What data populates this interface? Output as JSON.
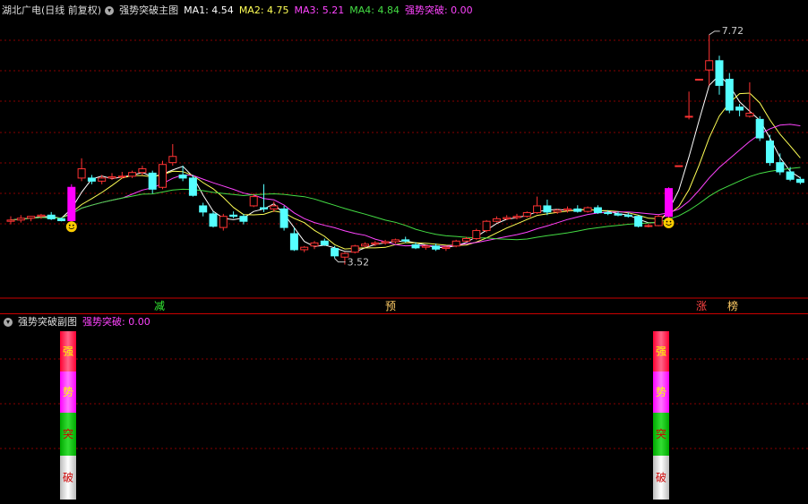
{
  "main": {
    "title": "湖北广电(日线 前复权)",
    "indicator": "强势突破主图",
    "ma": [
      {
        "label": "MA1: 4.54",
        "color": "#ffffff"
      },
      {
        "label": "MA2: 4.75",
        "color": "#ffff55"
      },
      {
        "label": "MA3: 5.21",
        "color": "#ff44ff"
      },
      {
        "label": "MA4: 4.84",
        "color": "#44dd44"
      }
    ],
    "signal": {
      "label": "强势突破: 0.00",
      "color": "#ff44ff"
    },
    "high_label": "7.72",
    "low_label": "3.52",
    "markers": [
      "减",
      "预",
      "涨",
      "榜"
    ]
  },
  "sub": {
    "indicator": "强势突破副图",
    "signal": {
      "label": "强势突破: 0.00",
      "color": "#ff44ff"
    },
    "bar_chars": [
      "强",
      "势",
      "突",
      "破"
    ]
  },
  "colors": {
    "up": "#ff3333",
    "down": "#55ffff",
    "grid": "#880000",
    "highlight": "#ff00ff"
  },
  "chart_data": {
    "type": "candlestick",
    "candles": [
      [
        4.7,
        4.78,
        4.65,
        4.72
      ],
      [
        4.72,
        4.8,
        4.68,
        4.75
      ],
      [
        4.75,
        4.78,
        4.7,
        4.78
      ],
      [
        4.78,
        4.82,
        4.74,
        4.8
      ],
      [
        4.8,
        4.85,
        4.72,
        4.74
      ],
      [
        4.74,
        4.76,
        4.7,
        4.71
      ],
      [
        4.71,
        5.3,
        4.7,
        5.25
      ],
      [
        5.4,
        5.72,
        5.35,
        5.55
      ],
      [
        5.4,
        5.45,
        5.3,
        5.35
      ],
      [
        5.35,
        5.45,
        5.3,
        5.4
      ],
      [
        5.4,
        5.48,
        5.37,
        5.42
      ],
      [
        5.42,
        5.5,
        5.39,
        5.43
      ],
      [
        5.43,
        5.52,
        5.4,
        5.49
      ],
      [
        5.49,
        5.6,
        5.45,
        5.55
      ],
      [
        5.48,
        5.52,
        5.15,
        5.22
      ],
      [
        5.25,
        5.68,
        5.22,
        5.62
      ],
      [
        5.65,
        5.95,
        5.6,
        5.75
      ],
      [
        5.45,
        5.6,
        5.35,
        5.4
      ],
      [
        5.4,
        5.45,
        5.1,
        5.12
      ],
      [
        4.95,
        5.0,
        4.78,
        4.85
      ],
      [
        4.82,
        4.86,
        4.6,
        4.62
      ],
      [
        4.6,
        4.82,
        4.55,
        4.78
      ],
      [
        4.8,
        4.86,
        4.75,
        4.78
      ],
      [
        4.78,
        4.82,
        4.65,
        4.7
      ],
      [
        4.95,
        5.15,
        4.93,
        5.1
      ],
      [
        4.92,
        5.3,
        4.85,
        4.9
      ],
      [
        4.9,
        5.02,
        4.85,
        4.95
      ],
      [
        4.9,
        4.95,
        4.55,
        4.6
      ],
      [
        4.5,
        4.6,
        4.22,
        4.24
      ],
      [
        4.24,
        4.3,
        4.2,
        4.28
      ],
      [
        4.3,
        4.38,
        4.25,
        4.35
      ],
      [
        4.38,
        4.42,
        4.3,
        4.32
      ],
      [
        4.26,
        4.3,
        4.1,
        4.14
      ],
      [
        4.12,
        4.2,
        4.0,
        4.18
      ],
      [
        4.2,
        4.32,
        4.18,
        4.3
      ],
      [
        4.3,
        4.36,
        4.28,
        4.33
      ],
      [
        4.33,
        4.38,
        4.3,
        4.35
      ],
      [
        4.35,
        4.4,
        4.32,
        4.37
      ],
      [
        4.37,
        4.42,
        4.34,
        4.4
      ],
      [
        4.4,
        4.45,
        4.35,
        4.38
      ],
      [
        4.32,
        4.36,
        4.25,
        4.27
      ],
      [
        4.28,
        4.32,
        4.24,
        4.3
      ],
      [
        4.3,
        4.34,
        4.22,
        4.25
      ],
      [
        4.26,
        4.3,
        4.22,
        4.28
      ],
      [
        4.3,
        4.4,
        4.28,
        4.38
      ],
      [
        4.38,
        4.45,
        4.36,
        4.42
      ],
      [
        4.42,
        4.58,
        4.4,
        4.55
      ],
      [
        4.55,
        4.72,
        4.52,
        4.7
      ],
      [
        4.7,
        4.78,
        4.68,
        4.74
      ],
      [
        4.74,
        4.8,
        4.72,
        4.76
      ],
      [
        4.76,
        4.82,
        4.73,
        4.78
      ],
      [
        4.78,
        4.86,
        4.76,
        4.84
      ],
      [
        4.84,
        5.1,
        4.82,
        4.95
      ],
      [
        4.95,
        5.05,
        4.8,
        4.85
      ],
      [
        4.85,
        4.9,
        4.82,
        4.88
      ],
      [
        4.88,
        4.94,
        4.84,
        4.9
      ],
      [
        4.9,
        4.96,
        4.84,
        4.86
      ],
      [
        4.86,
        4.94,
        4.84,
        4.92
      ],
      [
        4.92,
        4.96,
        4.82,
        4.84
      ],
      [
        4.84,
        4.88,
        4.8,
        4.83
      ],
      [
        4.82,
        4.86,
        4.78,
        4.8
      ],
      [
        4.8,
        4.84,
        4.76,
        4.78
      ],
      [
        4.78,
        4.8,
        4.6,
        4.62
      ],
      [
        4.62,
        4.66,
        4.6,
        4.63
      ],
      [
        4.63,
        4.8,
        4.62,
        4.78
      ],
      [
        4.78,
        5.25,
        4.76,
        5.23
      ],
      [
        5.6,
        5.6,
        5.6,
        5.6
      ],
      [
        6.4,
        6.8,
        6.35,
        6.4
      ],
      [
        7.0,
        7.0,
        7.0,
        7.0
      ],
      [
        7.15,
        7.72,
        6.9,
        7.3
      ],
      [
        7.3,
        7.38,
        6.75,
        6.9
      ],
      [
        7.0,
        7.1,
        6.45,
        6.5
      ],
      [
        6.55,
        6.6,
        6.4,
        6.5
      ],
      [
        6.4,
        6.95,
        6.38,
        6.45
      ],
      [
        6.35,
        6.4,
        6.0,
        6.05
      ],
      [
        6.0,
        6.1,
        5.6,
        5.65
      ],
      [
        5.65,
        5.8,
        5.45,
        5.5
      ],
      [
        5.5,
        5.58,
        5.35,
        5.38
      ],
      [
        5.38,
        5.42,
        5.3,
        5.33
      ]
    ]
  }
}
